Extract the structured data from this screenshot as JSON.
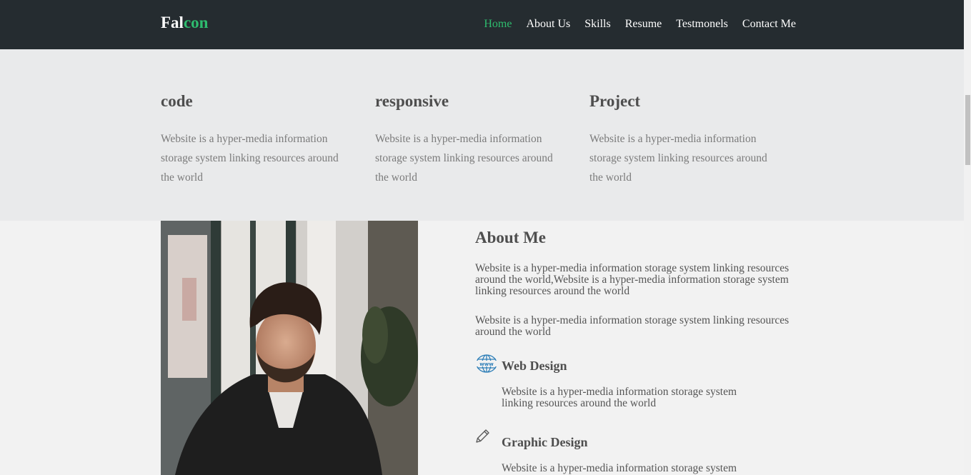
{
  "brand": {
    "part1": "Fal",
    "part2": "con"
  },
  "nav": {
    "items": [
      {
        "label": "Home",
        "active": true
      },
      {
        "label": "About Us"
      },
      {
        "label": "Skills"
      },
      {
        "label": "Resume"
      },
      {
        "label": "Testmonels"
      },
      {
        "label": "Contact Me"
      }
    ]
  },
  "features": [
    {
      "title": "code",
      "text": "Website is a hyper-media information storage system linking resources around the world"
    },
    {
      "title": "responsive",
      "text": "Website is a hyper-media information storage system linking resources around the world"
    },
    {
      "title": "Project",
      "text": "Website is a hyper-media information storage system linking resources around the world"
    }
  ],
  "about": {
    "title": "About Me",
    "paragraph1": "Website is a hyper-media information storage system linking resources around the world,Website is a hyper-media information storage system linking resources around the world",
    "paragraph2": "Website is a hyper-media information storage system linking resources around the world",
    "services": [
      {
        "icon": "globe-www-icon",
        "title": "Web Design",
        "text": "Website is a hyper-media information storage system linking resources around the world"
      },
      {
        "icon": "pencil-icon",
        "title": "Graphic Design",
        "text": "Website is a hyper-media information storage system"
      }
    ]
  },
  "colors": {
    "accent": "#2ebc6e",
    "navbar_bg": "#252c30",
    "features_bg": "#e9eaeb",
    "page_bg": "#f2f2f2",
    "icon_blue": "#2f7fb8"
  }
}
